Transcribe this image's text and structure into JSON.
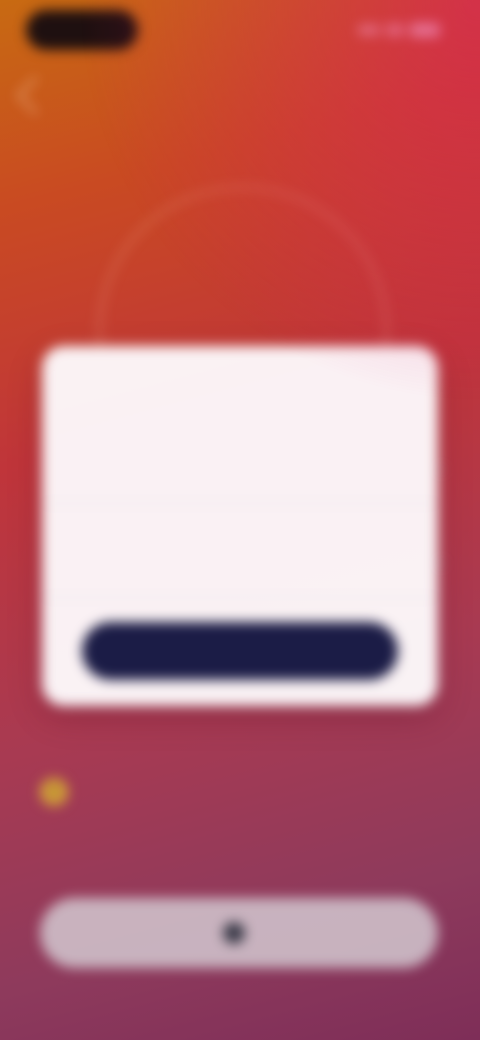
{
  "header": {
    "title": ""
  },
  "dialog": {
    "title": "",
    "rows": [
      {
        "label": "",
        "value": ""
      },
      {
        "label": "",
        "value": ""
      }
    ],
    "primary_button_label": ""
  },
  "info": {
    "title": "",
    "side": "",
    "subtitle": ""
  },
  "bottom_button": {
    "label": ""
  },
  "colors": {
    "primary_button": "#1b1c46",
    "warning_icon": "#d4a33a",
    "card_background": "#fcf8fa"
  },
  "icons": {
    "back": "back-icon",
    "warning": "warning-icon",
    "bottom_button": "button-icon"
  }
}
